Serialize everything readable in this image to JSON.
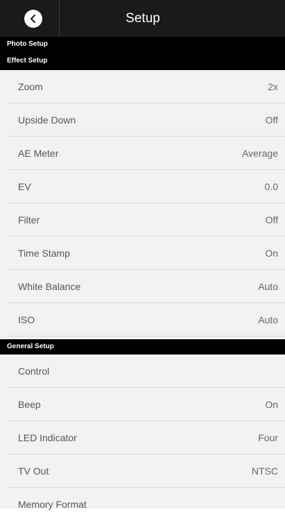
{
  "header": {
    "title": "Setup",
    "back_icon": "chevron-left-icon"
  },
  "sections": {
    "photo": "Photo Setup",
    "effect": "Effect Setup",
    "general": "General Setup"
  },
  "effect_items": [
    {
      "label": "Zoom",
      "value": "2x"
    },
    {
      "label": "Upside Down",
      "value": "Off"
    },
    {
      "label": "AE Meter",
      "value": "Average"
    },
    {
      "label": "EV",
      "value": "0.0"
    },
    {
      "label": "Filter",
      "value": "Off"
    },
    {
      "label": "Time Stamp",
      "value": "On"
    },
    {
      "label": "White Balance",
      "value": "Auto"
    },
    {
      "label": "ISO",
      "value": "Auto"
    }
  ],
  "general_items": [
    {
      "label": "Control",
      "value": ""
    },
    {
      "label": "Beep",
      "value": "On"
    },
    {
      "label": "LED Indicator",
      "value": "Four"
    },
    {
      "label": "TV Out",
      "value": "NTSC"
    },
    {
      "label": "Memory Format",
      "value": ""
    }
  ]
}
